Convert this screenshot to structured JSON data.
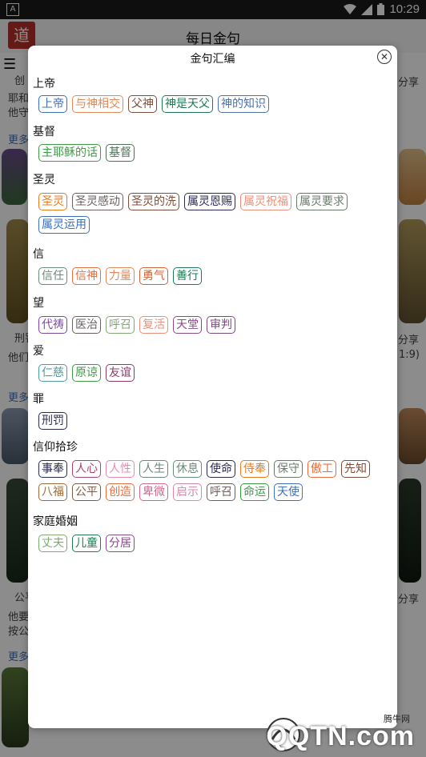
{
  "statusbar": {
    "time": "10:29",
    "notify_icon": "A"
  },
  "appbar": {
    "title": "每日金句",
    "logo_text": "道"
  },
  "background": {
    "snippets": [
      "创",
      "耶和",
      "他守",
      "更多",
      "刑罚",
      "他们",
      "更多",
      "公平",
      "他要",
      "按公",
      "更多",
      "分享",
      "分享",
      "1:9)",
      "分享"
    ]
  },
  "dialog": {
    "title": "金句汇编",
    "categories": [
      {
        "name": "上帝",
        "tags": [
          {
            "label": "上帝",
            "color": "#3f6fb5"
          },
          {
            "label": "与神相交",
            "color": "#e08a5a"
          },
          {
            "label": "父神",
            "color": "#7a4e3a"
          },
          {
            "label": "神是天父",
            "color": "#1f7a54"
          },
          {
            "label": "神的知识",
            "color": "#4e6fa8"
          }
        ]
      },
      {
        "name": "基督",
        "tags": [
          {
            "label": "主耶稣的话",
            "color": "#3e9a46"
          },
          {
            "label": "基督",
            "color": "#4f6e5a"
          }
        ]
      },
      {
        "name": "圣灵",
        "tags": [
          {
            "label": "圣灵",
            "color": "#e67b1d"
          },
          {
            "label": "圣灵感动",
            "color": "#6b5f5f"
          },
          {
            "label": "圣灵的洗",
            "color": "#7a4e3a"
          },
          {
            "label": "属灵恩赐",
            "color": "#2b2b52"
          },
          {
            "label": "属灵祝福",
            "color": "#e8917a"
          },
          {
            "label": "属灵要求",
            "color": "#6a7a6a"
          },
          {
            "label": "属灵运用",
            "color": "#3f6fb5"
          }
        ]
      },
      {
        "name": "信",
        "tags": [
          {
            "label": "信任",
            "color": "#6a8a7a"
          },
          {
            "label": "信神",
            "color": "#e07040"
          },
          {
            "label": "力量",
            "color": "#e08a5a"
          },
          {
            "label": "勇气",
            "color": "#c9663a"
          },
          {
            "label": "善行",
            "color": "#1f7a54"
          }
        ]
      },
      {
        "name": "望",
        "tags": [
          {
            "label": "代祷",
            "color": "#7b4aa0"
          },
          {
            "label": "医治",
            "color": "#6b5f5f"
          },
          {
            "label": "呼召",
            "color": "#7fa870"
          },
          {
            "label": "复活",
            "color": "#e8917a"
          },
          {
            "label": "天堂",
            "color": "#8a4a8a"
          },
          {
            "label": "审判",
            "color": "#7a4a7a"
          }
        ]
      },
      {
        "name": "爱",
        "tags": [
          {
            "label": "仁慈",
            "color": "#4f9aa0"
          },
          {
            "label": "原谅",
            "color": "#3e9a46"
          },
          {
            "label": "友谊",
            "color": "#8a3a6a"
          }
        ]
      },
      {
        "name": "罪",
        "tags": [
          {
            "label": "刑罚",
            "color": "#2b2b52"
          }
        ]
      },
      {
        "name": "信仰拾珍",
        "tags": [
          {
            "label": "事奉",
            "color": "#2b2b52"
          },
          {
            "label": "人心",
            "color": "#a8446a"
          },
          {
            "label": "人性",
            "color": "#e68ab0"
          },
          {
            "label": "人生",
            "color": "#6a8a7a"
          },
          {
            "label": "休息",
            "color": "#6a8a7a"
          },
          {
            "label": "使命",
            "color": "#2b2b52"
          },
          {
            "label": "侍奉",
            "color": "#e67b1d"
          },
          {
            "label": "保守",
            "color": "#6a7a6a"
          },
          {
            "label": "傲工",
            "color": "#e07040"
          },
          {
            "label": "先知",
            "color": "#7a4e3a"
          },
          {
            "label": "八福",
            "color": "#9a6a3a"
          },
          {
            "label": "公平",
            "color": "#7a5a4a"
          },
          {
            "label": "创造",
            "color": "#e07040"
          },
          {
            "label": "卑微",
            "color": "#c96a8a"
          },
          {
            "label": "启示",
            "color": "#d48aa8"
          },
          {
            "label": "呼召",
            "color": "#6b5f5f"
          },
          {
            "label": "命运",
            "color": "#3e9a46"
          },
          {
            "label": "天使",
            "color": "#3f6fb5"
          }
        ]
      },
      {
        "name": "家庭婚姻",
        "tags": [
          {
            "label": "丈夫",
            "color": "#7fa870"
          },
          {
            "label": "儿童",
            "color": "#1f7a54"
          },
          {
            "label": "分居",
            "color": "#8a4a8a"
          }
        ]
      }
    ]
  },
  "watermark": {
    "brand_en": "QQTN.com",
    "brand_cn": "腾牛网"
  },
  "icons": {
    "menu": "menu-icon",
    "close": "close-icon",
    "wifi": "wifi-icon",
    "battery": "battery-icon"
  }
}
